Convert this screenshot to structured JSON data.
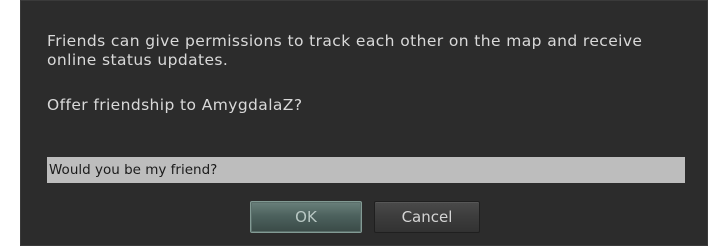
{
  "dialog": {
    "message": "Friends can give permissions to track each other on the map and receive online status updates.",
    "question": "Offer friendship to AmygdalaZ?",
    "message_field": {
      "value": "Would you be my friend?"
    },
    "buttons": {
      "ok_label": "OK",
      "cancel_label": "Cancel"
    }
  },
  "colors": {
    "dialog_background": "#2c2c2c",
    "text": "#d9d9d9",
    "field_background": "#bdbdbd",
    "ok_button": "#4d625e",
    "cancel_button": "#3c3c3c"
  }
}
